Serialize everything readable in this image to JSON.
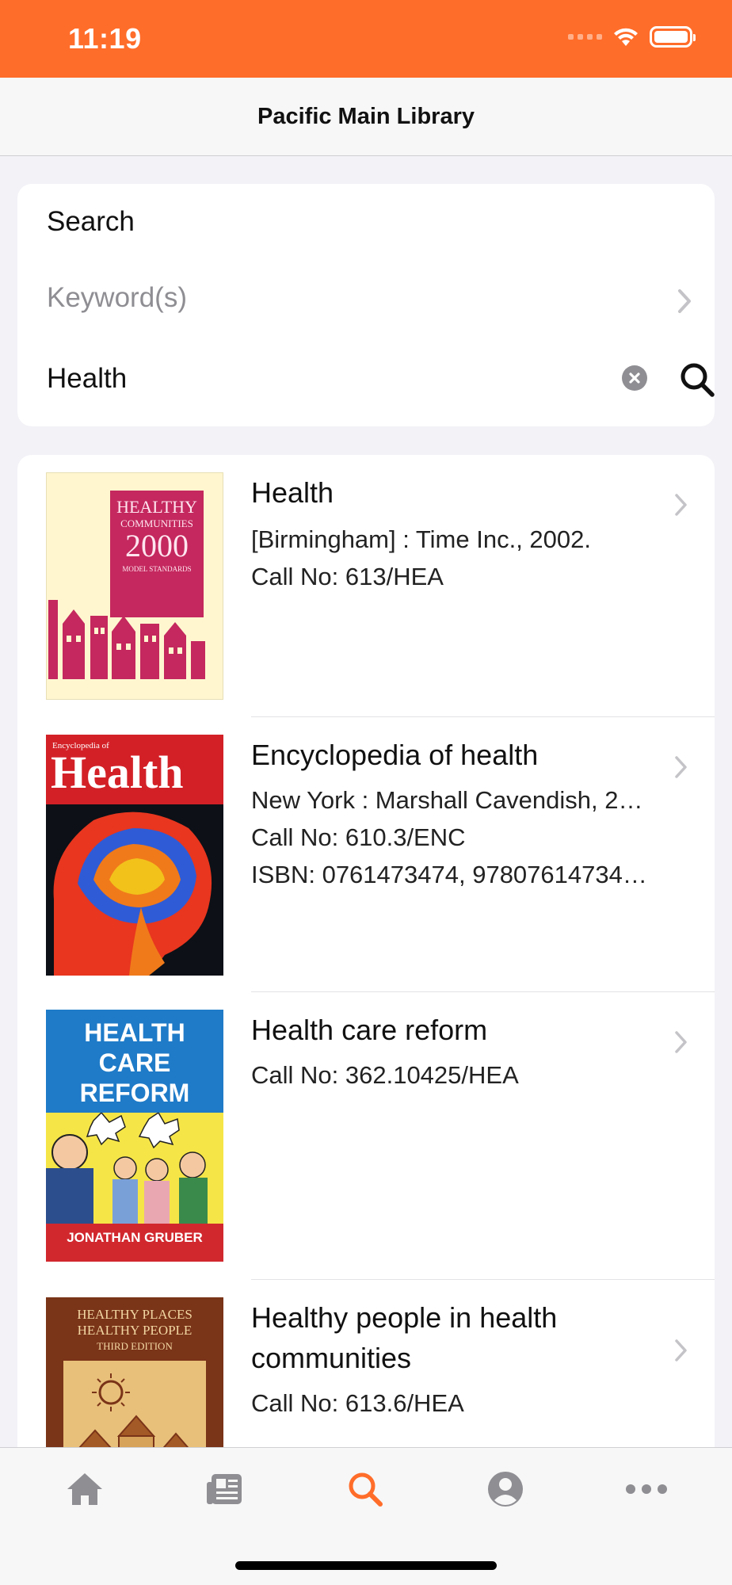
{
  "status": {
    "time": "11:19"
  },
  "nav": {
    "title": "Pacific Main Library"
  },
  "search": {
    "label": "Search",
    "keyword_label": "Keyword(s)",
    "query": "Health"
  },
  "results": [
    {
      "title": "Health",
      "lines": [
        "[Birmingham] : Time Inc., 2002.",
        "Call No: 613/HEA"
      ],
      "cover": {
        "line1": "HEALTHY",
        "line2": "COMMUNITIES",
        "line3": "2000",
        "line4": "MODEL STANDARDS",
        "bg": "#FFF6D0",
        "accent": "#C4285E"
      }
    },
    {
      "title": "Encyclopedia of health",
      "lines": [
        "New York : Marshall Cavendish, 2…",
        "Call No: 610.3/ENC",
        "ISBN: 0761473474, 97807614734…"
      ],
      "cover": {
        "small": "Encyclopedia of",
        "big": "Health",
        "bg": "#D32027"
      }
    },
    {
      "title": "Health care reform",
      "lines": [
        "Call No: 362.10425/HEA"
      ],
      "cover": {
        "line1": "HEALTH",
        "line2": "CARE",
        "line3": "REFORM",
        "author": "JONATHAN GRUBER",
        "bg": "#1F7BC8"
      }
    },
    {
      "title": "Healthy people in health communities",
      "lines": [
        "Call No: 613.6/HEA"
      ],
      "cover": {
        "line1": "HEALTHY PLACES",
        "line2": "HEALTHY PEOPLE",
        "line3": "THIRD EDITION",
        "bg": "#7A3418"
      }
    }
  ],
  "tabs": [
    {
      "name": "home-icon",
      "active": false
    },
    {
      "name": "news-icon",
      "active": false
    },
    {
      "name": "search-icon",
      "active": true
    },
    {
      "name": "account-icon",
      "active": false
    },
    {
      "name": "more-icon",
      "active": false
    }
  ],
  "colors": {
    "brand": "#FF6D2A",
    "tab_inactive": "#8E8E93"
  }
}
